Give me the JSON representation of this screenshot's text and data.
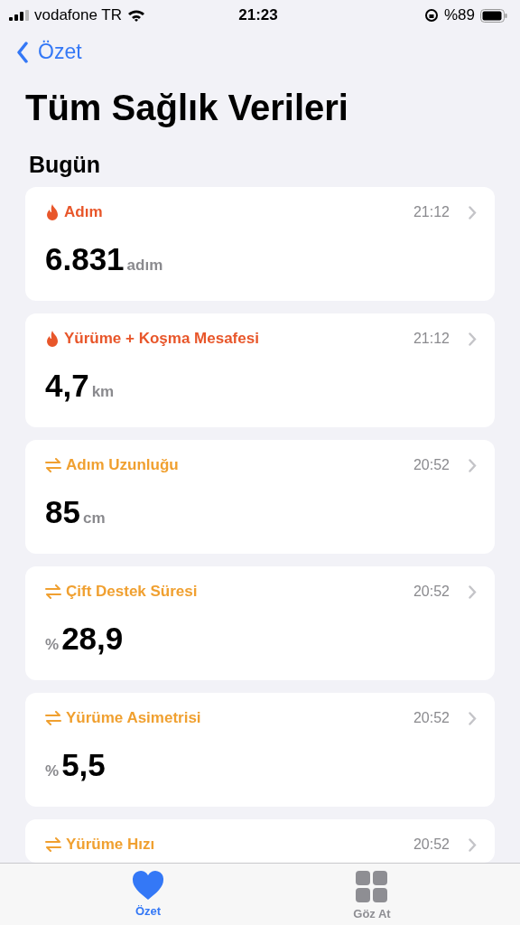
{
  "status_bar": {
    "carrier": "vodafone TR",
    "time": "21:23",
    "battery": "%89"
  },
  "nav": {
    "back": "Özet"
  },
  "title": "Tüm Sağlık Verileri",
  "section": "Bugün",
  "cards": [
    {
      "kind": "activity",
      "title": "Adım",
      "time": "21:12",
      "value": "6.831",
      "unit": "adım"
    },
    {
      "kind": "activity",
      "title": "Yürüme + Koşma Mesafesi",
      "time": "21:12",
      "value": "4,7",
      "unit": "km"
    },
    {
      "kind": "mobility",
      "title": "Adım Uzunluğu",
      "time": "20:52",
      "value": "85",
      "unit": "cm"
    },
    {
      "kind": "mobility",
      "title": "Çift Destek Süresi",
      "time": "20:52",
      "prefix": "%",
      "value": "28,9"
    },
    {
      "kind": "mobility",
      "title": "Yürüme Asimetrisi",
      "time": "20:52",
      "prefix": "%",
      "value": "5,5"
    },
    {
      "kind": "mobility",
      "title": "Yürüme Hızı",
      "time": "20:52"
    }
  ],
  "tabs": [
    {
      "label": "Özet",
      "kind": "heart",
      "selected": true
    },
    {
      "label": "Göz At",
      "kind": "grid",
      "selected": false
    }
  ]
}
